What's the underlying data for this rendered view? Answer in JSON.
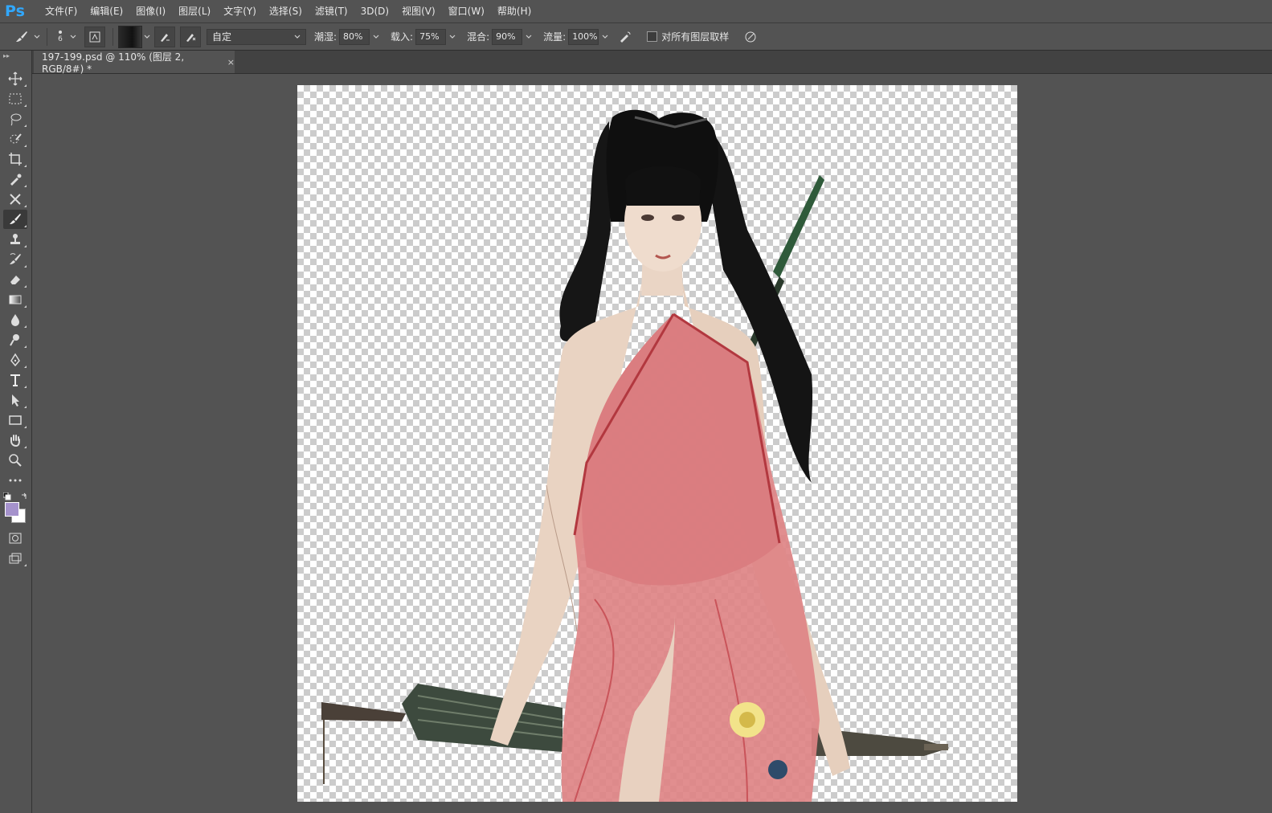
{
  "app": {
    "logo": "Ps"
  },
  "menu": {
    "items": [
      "文件(F)",
      "编辑(E)",
      "图像(I)",
      "图层(L)",
      "文字(Y)",
      "选择(S)",
      "滤镜(T)",
      "3D(D)",
      "视图(V)",
      "窗口(W)",
      "帮助(H)"
    ]
  },
  "options": {
    "brush_size": "6",
    "preset_value": "自定",
    "wetness_label": "潮湿:",
    "wetness_value": "80%",
    "load_label": "载入:",
    "load_value": "75%",
    "mix_label": "混合:",
    "mix_value": "90%",
    "flow_label": "流量:",
    "flow_value": "100%",
    "sample_all_label": "对所有图层取样",
    "sample_all_checked": false
  },
  "document": {
    "tab_title": "197-199.psd @ 110% (图层 2, RGB/8#) *",
    "close_glyph": "×"
  },
  "toolbox": {
    "foreground_color": "#a592cc",
    "background_color": "#ffffff",
    "active_tool": "mixer-brush-tool",
    "tools": [
      "move",
      "rectangular-marquee",
      "lasso",
      "quick-selection",
      "crop",
      "eyedropper",
      "healing-brush",
      "mixer-brush",
      "clone-stamp",
      "history-brush",
      "eraser",
      "gradient",
      "blur",
      "dodge",
      "pen",
      "type",
      "path-selection",
      "rectangle",
      "hand",
      "zoom",
      "more"
    ]
  },
  "colors": {
    "accent_logo": "#31a8ff",
    "ui_background": "#535353",
    "tab_background": "#424242"
  }
}
